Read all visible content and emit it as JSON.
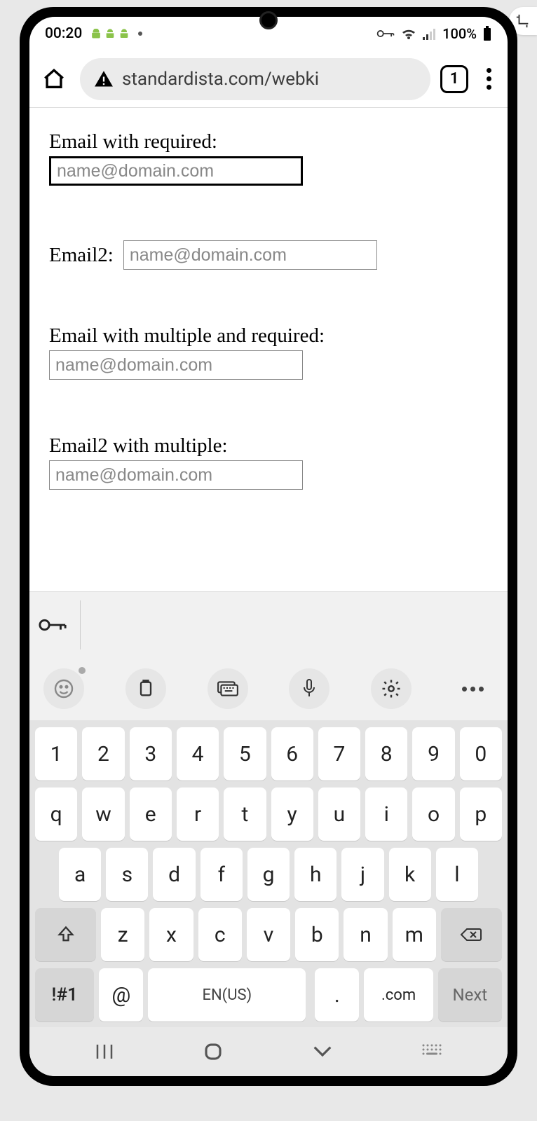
{
  "status": {
    "time": "00:20",
    "battery_text": "100%"
  },
  "browser": {
    "url_display": "standardista.com/webki",
    "tab_count": "1"
  },
  "form": {
    "f1": {
      "label": "Email with required:",
      "placeholder": "name@domain.com"
    },
    "f2": {
      "label": "Email2:",
      "placeholder": "name@domain.com"
    },
    "f3": {
      "label": "Email with multiple and required:",
      "placeholder": "name@domain.com"
    },
    "f4": {
      "label": "Email2 with multiple:",
      "placeholder": "name@domain.com"
    }
  },
  "keyboard": {
    "row_num": [
      "1",
      "2",
      "3",
      "4",
      "5",
      "6",
      "7",
      "8",
      "9",
      "0"
    ],
    "row1": [
      "q",
      "w",
      "e",
      "r",
      "t",
      "y",
      "u",
      "i",
      "o",
      "p"
    ],
    "row2": [
      "a",
      "s",
      "d",
      "f",
      "g",
      "h",
      "j",
      "k",
      "l"
    ],
    "row3": [
      "z",
      "x",
      "c",
      "v",
      "b",
      "n",
      "m"
    ],
    "sym": "!#1",
    "at": "@",
    "space": "EN(US)",
    "dot": ".",
    "com": ".com",
    "next": "Next"
  }
}
